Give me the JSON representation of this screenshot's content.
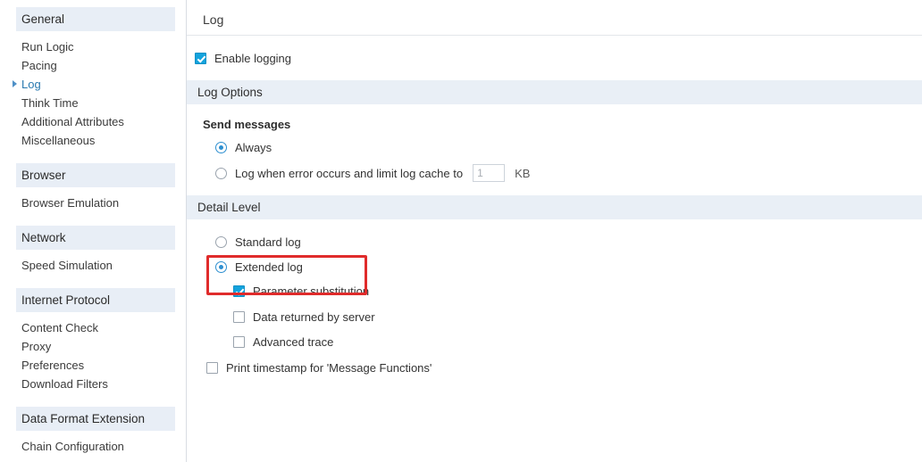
{
  "sidebar": {
    "groups": [
      {
        "header": "General",
        "items": [
          {
            "label": "Run Logic",
            "active": false
          },
          {
            "label": "Pacing",
            "active": false
          },
          {
            "label": "Log",
            "active": true
          },
          {
            "label": "Think Time",
            "active": false
          },
          {
            "label": "Additional Attributes",
            "active": false
          },
          {
            "label": "Miscellaneous",
            "active": false
          }
        ]
      },
      {
        "header": "Browser",
        "items": [
          {
            "label": "Browser Emulation",
            "active": false
          }
        ]
      },
      {
        "header": "Network",
        "items": [
          {
            "label": "Speed Simulation",
            "active": false
          }
        ]
      },
      {
        "header": "Internet Protocol",
        "items": [
          {
            "label": "Content Check",
            "active": false
          },
          {
            "label": "Proxy",
            "active": false
          },
          {
            "label": "Preferences",
            "active": false
          },
          {
            "label": "Download Filters",
            "active": false
          }
        ]
      },
      {
        "header": "Data Format Extension",
        "items": [
          {
            "label": "Chain Configuration",
            "active": false
          }
        ]
      }
    ]
  },
  "main": {
    "page_title": "Log",
    "enable_logging": {
      "label": "Enable logging",
      "checked": true
    },
    "log_options": {
      "section_title": "Log Options",
      "send_messages_label": "Send messages",
      "always": {
        "label": "Always",
        "selected": true
      },
      "log_on_error": {
        "label": "Log when error occurs and limit log cache to",
        "selected": false,
        "cache_value": "1",
        "cache_unit": "KB"
      }
    },
    "detail_level": {
      "section_title": "Detail Level",
      "standard_log": {
        "label": "Standard log",
        "selected": false
      },
      "extended_log": {
        "label": "Extended log",
        "selected": true
      },
      "parameter_substitution": {
        "label": "Parameter substitution",
        "checked": true
      },
      "data_returned_by_server": {
        "label": "Data returned by server",
        "checked": false
      },
      "advanced_trace": {
        "label": "Advanced trace",
        "checked": false
      },
      "print_timestamp": {
        "label": "Print timestamp for 'Message Functions'",
        "checked": false
      }
    }
  },
  "annotation": {
    "highlight_color": "#e02b2b",
    "target": "extended-log-and-parameter-substitution"
  },
  "colors": {
    "accent_checkbox": "#13a3dd",
    "accent_radio": "#2d8fd0",
    "section_bar_bg": "#e9eff6",
    "sidebar_group_bg": "#e8eef6",
    "active_link": "#2a7ab0"
  }
}
